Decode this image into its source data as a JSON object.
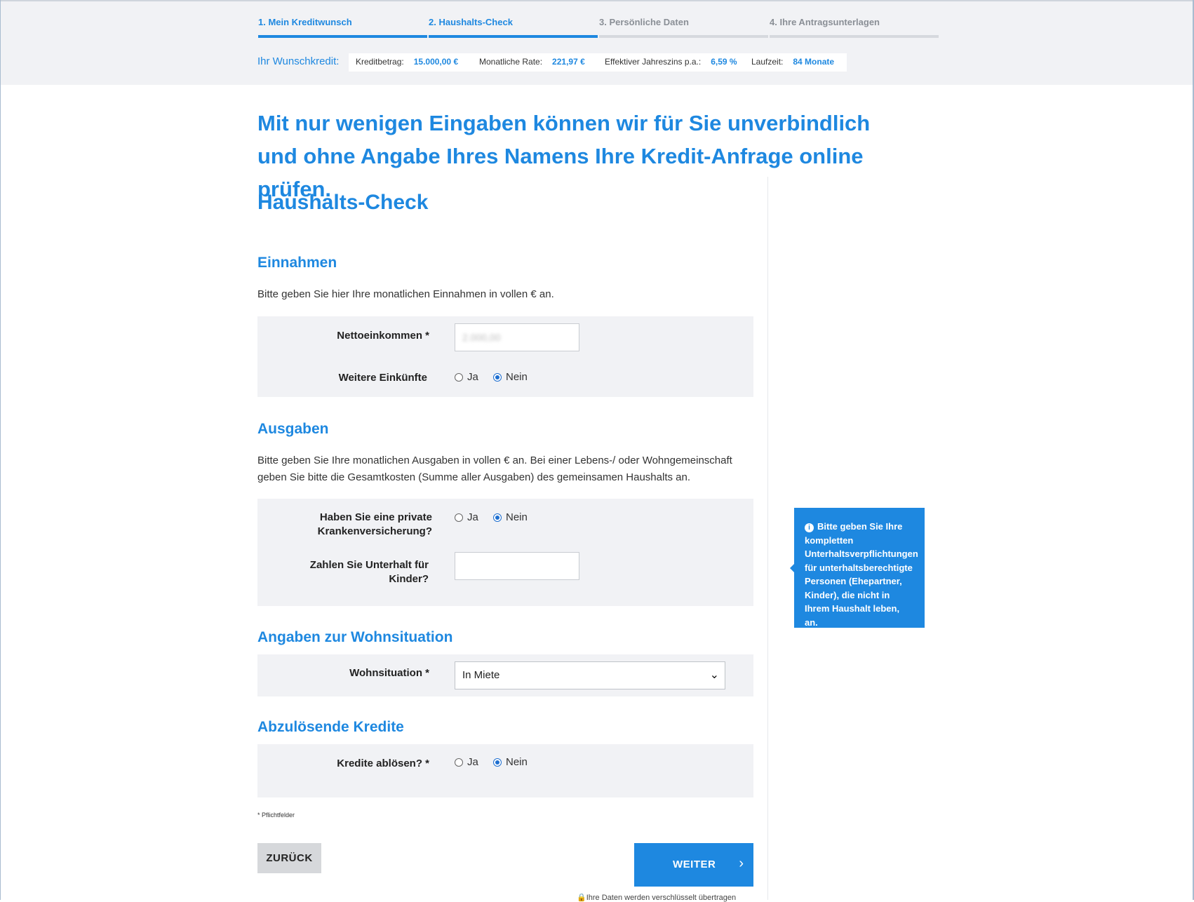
{
  "steps": [
    {
      "label": "1. Mein Kreditwunsch",
      "state": "active"
    },
    {
      "label": "2. Haushalts-Check",
      "state": "active"
    },
    {
      "label": "3. Persönliche Daten",
      "state": "inactive"
    },
    {
      "label": "4. Ihre Antragsunterlagen",
      "state": "inactive"
    }
  ],
  "summary": {
    "title": "Ihr Wunschkredit:",
    "kreditbetrag_label": "Kreditbetrag:",
    "kreditbetrag_value": "15.000,00 €",
    "rate_label": "Monatliche Rate:",
    "rate_value": "221,97 €",
    "zins_label": "Effektiver Jahreszins p.a.:",
    "zins_value": "6,59 %",
    "laufzeit_label": "Laufzeit:",
    "laufzeit_value": "84 Monate"
  },
  "headline": "Mit nur wenigen Eingaben können wir für Sie unverbindlich und ohne Angabe Ihres Namens Ihre Kredit-Anfrage online prüfen.",
  "page_title": "Haushalts-Check",
  "einnahmen": {
    "title": "Einnahmen",
    "desc": "Bitte geben Sie hier Ihre monatlichen Einnahmen in vollen € an.",
    "netto_label": "Nettoeinkommen *",
    "netto_value": "2.000,00",
    "weitere_label": "Weitere Einkünfte",
    "weitere_selected": "Nein"
  },
  "ausgaben": {
    "title": "Ausgaben",
    "desc_line1": "Bitte geben Sie Ihre monatlichen Ausgaben in vollen € an. Bei einer Lebens-/ oder Wohngemeinschaft",
    "desc_line2": "geben Sie bitte die Gesamtkosten (Summe aller Ausgaben) des gemeinsamen Haushalts an.",
    "pkv_label_line1": "Haben Sie eine private",
    "pkv_label_line2": "Krankenversicherung?",
    "pkv_selected": "Nein",
    "unterhalt_label_line1": "Zahlen Sie Unterhalt für",
    "unterhalt_label_line2": "Kinder?",
    "unterhalt_value": ""
  },
  "radio": {
    "ja": "Ja",
    "nein": "Nein"
  },
  "wohnen": {
    "title": "Angaben zur Wohnsituation",
    "label": "Wohnsituation *",
    "selected": "In Miete"
  },
  "kredite": {
    "title": "Abzulösende Kredite",
    "label": "Kredite ablösen? *",
    "selected": "Nein"
  },
  "tooltip": {
    "text": "Bitte geben Sie Ihre kompletten Unterhaltsverpflichtungen für unterhaltsberechtigte Personen (Ehepartner, Kinder), die nicht in Ihrem Haushalt leben, an."
  },
  "required_note": "* Pflichtfelder",
  "buttons": {
    "back": "ZURÜCK",
    "next": "WEITER",
    "next_arrow": "›"
  },
  "secure_note": "Ihre Daten werden verschlüsselt übertragen",
  "colors": {
    "accent": "#1e88e0",
    "panel": "#f1f2f5",
    "header": "#f1f2f5"
  }
}
